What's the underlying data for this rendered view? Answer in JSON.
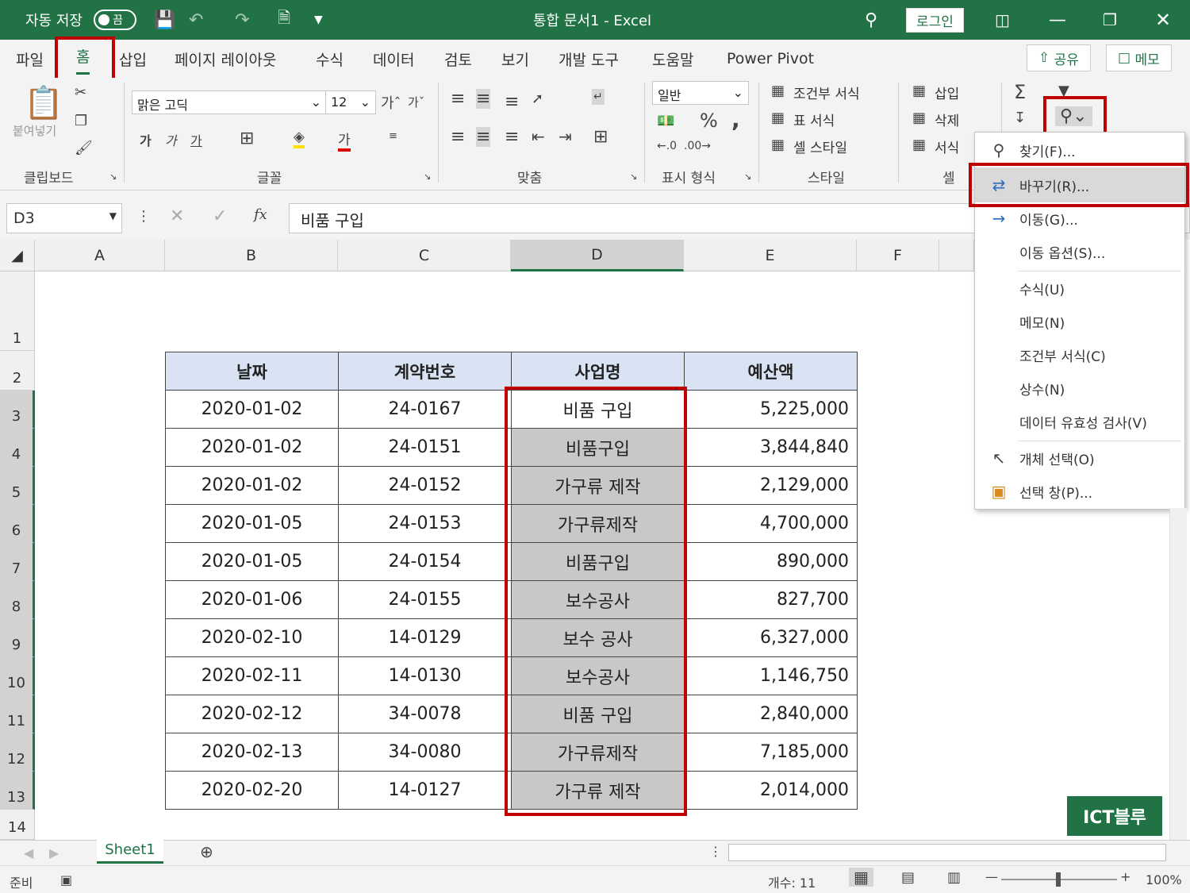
{
  "titlebar": {
    "autosave_label": "자동 저장",
    "autosave_state": "끔",
    "doc_title": "통합 문서1 - Excel",
    "login": "로그인"
  },
  "tabs": [
    "파일",
    "홈",
    "삽입",
    "페이지 레이아웃",
    "수식",
    "데이터",
    "검토",
    "보기",
    "개발 도구",
    "도움말",
    "Power Pivot"
  ],
  "share_label": "공유",
  "memo_label": "메모",
  "ribbon": {
    "clipboard": {
      "paste": "붙여넣기",
      "label": "클립보드"
    },
    "font": {
      "name": "맑은 고딕",
      "size": "12",
      "label": "글꼴",
      "bold": "가",
      "italic": "가",
      "underline": "가",
      "color_glyph": "가"
    },
    "align": {
      "label": "맞춤"
    },
    "number": {
      "format": "일반",
      "percent": "%",
      "comma": ",",
      "label": "표시 형식"
    },
    "styles": {
      "items": [
        "조건부 서식",
        "표 서식",
        "셀 스타일"
      ],
      "label": "스타일"
    },
    "cells": {
      "items": [
        "삽입",
        "삭제",
        "서식"
      ],
      "label": "셀"
    }
  },
  "formula": {
    "namebox": "D3",
    "fx": "fx",
    "content": "비품 구입"
  },
  "columns": [
    "A",
    "B",
    "C",
    "D",
    "E",
    "F"
  ],
  "rows": [
    "1",
    "2",
    "3",
    "4",
    "5",
    "6",
    "7",
    "8",
    "9",
    "10",
    "11",
    "12",
    "13",
    "14"
  ],
  "table": {
    "headers": [
      "날짜",
      "계약번호",
      "사업명",
      "예산액"
    ],
    "rows": [
      [
        "2020-01-02",
        "24-0167",
        "비품 구입",
        "5,225,000"
      ],
      [
        "2020-01-02",
        "24-0151",
        "비품구입",
        "3,844,840"
      ],
      [
        "2020-01-02",
        "24-0152",
        "가구류 제작",
        "2,129,000"
      ],
      [
        "2020-01-05",
        "24-0153",
        "가구류제작",
        "4,700,000"
      ],
      [
        "2020-01-05",
        "24-0154",
        "비품구입",
        "890,000"
      ],
      [
        "2020-01-06",
        "24-0155",
        "보수공사",
        "827,700"
      ],
      [
        "2020-02-10",
        "14-0129",
        "보수 공사",
        "6,327,000"
      ],
      [
        "2020-02-11",
        "14-0130",
        "보수공사",
        "1,146,750"
      ],
      [
        "2020-02-12",
        "34-0078",
        "비품 구입",
        "2,840,000"
      ],
      [
        "2020-02-13",
        "34-0080",
        "가구류제작",
        "7,185,000"
      ],
      [
        "2020-02-20",
        "14-0127",
        "가구류 제작",
        "2,014,000"
      ]
    ]
  },
  "menu": [
    {
      "label": "찾기(F)...",
      "icon": "search-icon"
    },
    {
      "label": "바꾸기(R)...",
      "icon": "replace-icon",
      "highlight": true
    },
    {
      "label": "이동(G)...",
      "icon": "arrow-right-icon"
    },
    {
      "label": "이동 옵션(S)..."
    },
    {
      "label": "수식(U)"
    },
    {
      "label": "메모(N)"
    },
    {
      "label": "조건부 서식(C)"
    },
    {
      "label": "상수(N)"
    },
    {
      "label": "데이터 유효성 검사(V)"
    },
    {
      "label": "개체 선택(O)",
      "icon": "pointer-icon"
    },
    {
      "label": "선택 창(P)...",
      "icon": "selection-pane-icon"
    }
  ],
  "sheet": {
    "tab": "Sheet1"
  },
  "status": {
    "ready": "준비",
    "count": "개수: 11",
    "zoom": "100%"
  },
  "watermark": "ICT블루",
  "colors": {
    "excel_green": "#217346",
    "highlight_red": "#c00000",
    "header_blue": "#dae3f3",
    "selection_gray": "#c8c8c8"
  }
}
